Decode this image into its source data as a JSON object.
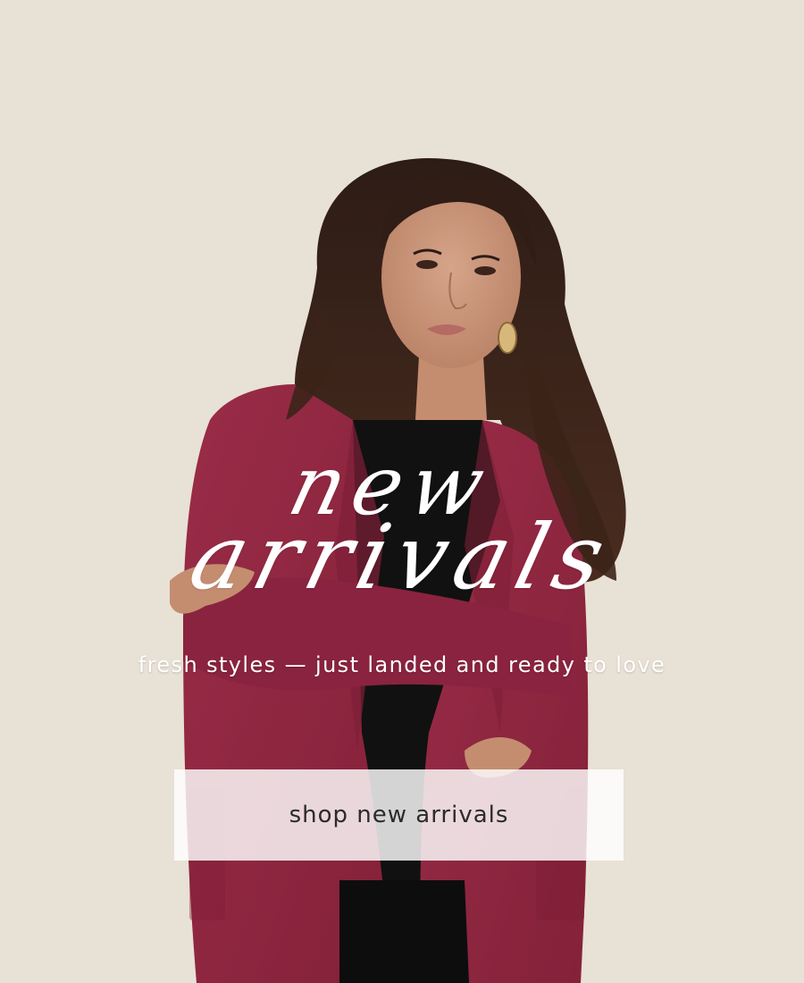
{
  "promo": {
    "headline_line1": "new",
    "headline_line2": "arrivals",
    "subtitle": "fresh styles — just landed and ready to love",
    "cta_label": "shop new arrivals"
  },
  "colors": {
    "background": "#e8e0d3",
    "cardigan": "#8f2540",
    "text": "#ffffff",
    "button_bg": "#ffffff",
    "button_text": "#2b2b2b"
  }
}
